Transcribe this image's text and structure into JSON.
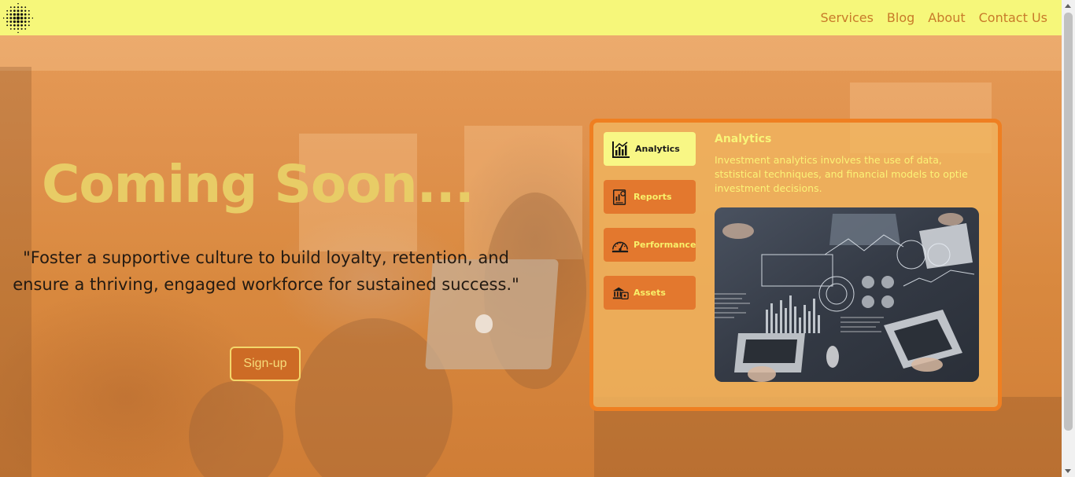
{
  "nav": {
    "logo": "dotted-circle-logo",
    "links": [
      "Services",
      "Blog",
      "About",
      "Contact Us"
    ]
  },
  "hero": {
    "title": "Coming Soon...",
    "quote": "\"Foster a supportive culture to build loyalty, retention, and ensure a thriving, engaged workforce for sustained success.\"",
    "signup_label": "Sign-up"
  },
  "tabs": {
    "items": [
      {
        "label": "Analytics",
        "icon": "analytics-chart-icon"
      },
      {
        "label": "Reports",
        "icon": "report-document-icon"
      },
      {
        "label": "Performance",
        "icon": "performance-gauge-icon"
      },
      {
        "label": "Assets",
        "icon": "assets-bank-icon"
      }
    ],
    "active_index": 0,
    "content": {
      "heading": "Analytics",
      "description": "Investment analytics involves the use of data, ststistical techniques, and financial models to optie investment decisions."
    }
  },
  "colors": {
    "navbar": "#f6f77a",
    "nav_link": "#c87a2a",
    "hero_title": "#e8cc66",
    "panel_border": "#ef7f21",
    "tab_active": "#f8f785",
    "tab_inactive": "#e3782e",
    "tab_text": "#f8f06a"
  }
}
